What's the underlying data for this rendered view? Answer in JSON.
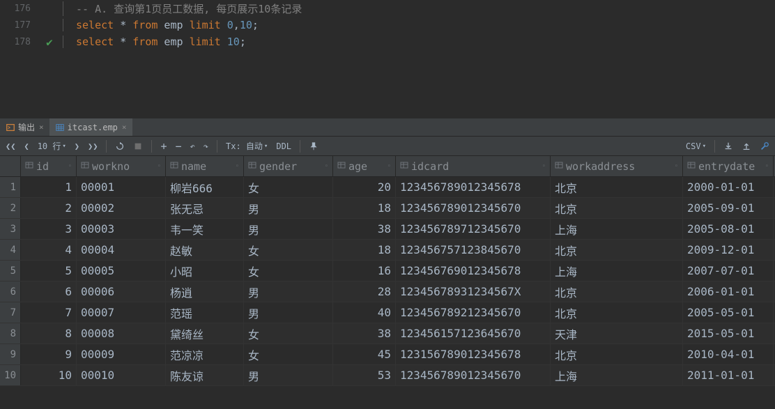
{
  "editor": {
    "lines": [
      {
        "num": "176",
        "tokens": [
          {
            "t": "-- A. 查询第1页员工数据, 每页展示10条记录",
            "c": "comment"
          }
        ],
        "check": false
      },
      {
        "num": "177",
        "tokens": [
          {
            "t": "select",
            "c": "kw"
          },
          {
            "t": " * ",
            "c": "op"
          },
          {
            "t": "from",
            "c": "kw"
          },
          {
            "t": " emp ",
            "c": "op"
          },
          {
            "t": "limit",
            "c": "kw"
          },
          {
            "t": " ",
            "c": "op"
          },
          {
            "t": "0",
            "c": "num"
          },
          {
            "t": ",",
            "c": "op"
          },
          {
            "t": "10",
            "c": "num"
          },
          {
            "t": ";",
            "c": "op"
          }
        ],
        "check": false
      },
      {
        "num": "178",
        "tokens": [
          {
            "t": "select",
            "c": "kw"
          },
          {
            "t": " * ",
            "c": "op"
          },
          {
            "t": "from",
            "c": "kw"
          },
          {
            "t": " emp ",
            "c": "op"
          },
          {
            "t": "limit",
            "c": "kw"
          },
          {
            "t": " ",
            "c": "op"
          },
          {
            "t": "10",
            "c": "num"
          },
          {
            "t": ";",
            "c": "op"
          }
        ],
        "check": true
      }
    ]
  },
  "tabs": {
    "output": "输出",
    "table": "itcast.emp"
  },
  "toolbar": {
    "rows_label": "10 行",
    "tx_label": "Tx: 自动",
    "ddl": "DDL",
    "csv": "CSV"
  },
  "columns": [
    {
      "key": "id",
      "label": "id",
      "w": "c-id",
      "align": "num"
    },
    {
      "key": "workno",
      "label": "workno",
      "w": "c-workno",
      "align": "text"
    },
    {
      "key": "name",
      "label": "name",
      "w": "c-name",
      "align": "text"
    },
    {
      "key": "gender",
      "label": "gender",
      "w": "c-gender",
      "align": "text"
    },
    {
      "key": "age",
      "label": "age",
      "w": "c-age",
      "align": "num"
    },
    {
      "key": "idcard",
      "label": "idcard",
      "w": "c-idcard",
      "align": "text"
    },
    {
      "key": "workaddress",
      "label": "workaddress",
      "w": "c-workaddress",
      "align": "text"
    },
    {
      "key": "entrydate",
      "label": "entrydate",
      "w": "c-entrydate",
      "align": "text"
    }
  ],
  "rows": [
    {
      "n": "1",
      "id": "1",
      "workno": "00001",
      "name": "柳岩666",
      "gender": "女",
      "age": "20",
      "idcard": "123456789012345678",
      "workaddress": "北京",
      "entrydate": "2000-01-01"
    },
    {
      "n": "2",
      "id": "2",
      "workno": "00002",
      "name": "张无忌",
      "gender": "男",
      "age": "18",
      "idcard": "123456789012345670",
      "workaddress": "北京",
      "entrydate": "2005-09-01"
    },
    {
      "n": "3",
      "id": "3",
      "workno": "00003",
      "name": "韦一笑",
      "gender": "男",
      "age": "38",
      "idcard": "123456789712345670",
      "workaddress": "上海",
      "entrydate": "2005-08-01"
    },
    {
      "n": "4",
      "id": "4",
      "workno": "00004",
      "name": "赵敏",
      "gender": "女",
      "age": "18",
      "idcard": "123456757123845670",
      "workaddress": "北京",
      "entrydate": "2009-12-01"
    },
    {
      "n": "5",
      "id": "5",
      "workno": "00005",
      "name": "小昭",
      "gender": "女",
      "age": "16",
      "idcard": "123456769012345678",
      "workaddress": "上海",
      "entrydate": "2007-07-01"
    },
    {
      "n": "6",
      "id": "6",
      "workno": "00006",
      "name": "杨逍",
      "gender": "男",
      "age": "28",
      "idcard": "12345678931234567X",
      "workaddress": "北京",
      "entrydate": "2006-01-01"
    },
    {
      "n": "7",
      "id": "7",
      "workno": "00007",
      "name": "范瑶",
      "gender": "男",
      "age": "40",
      "idcard": "123456789212345670",
      "workaddress": "北京",
      "entrydate": "2005-05-01"
    },
    {
      "n": "8",
      "id": "8",
      "workno": "00008",
      "name": "黛绮丝",
      "gender": "女",
      "age": "38",
      "idcard": "123456157123645670",
      "workaddress": "天津",
      "entrydate": "2015-05-01"
    },
    {
      "n": "9",
      "id": "9",
      "workno": "00009",
      "name": "范凉凉",
      "gender": "女",
      "age": "45",
      "idcard": "123156789012345678",
      "workaddress": "北京",
      "entrydate": "2010-04-01"
    },
    {
      "n": "10",
      "id": "10",
      "workno": "00010",
      "name": "陈友谅",
      "gender": "男",
      "age": "53",
      "idcard": "123456789012345670",
      "workaddress": "上海",
      "entrydate": "2011-01-01"
    }
  ]
}
